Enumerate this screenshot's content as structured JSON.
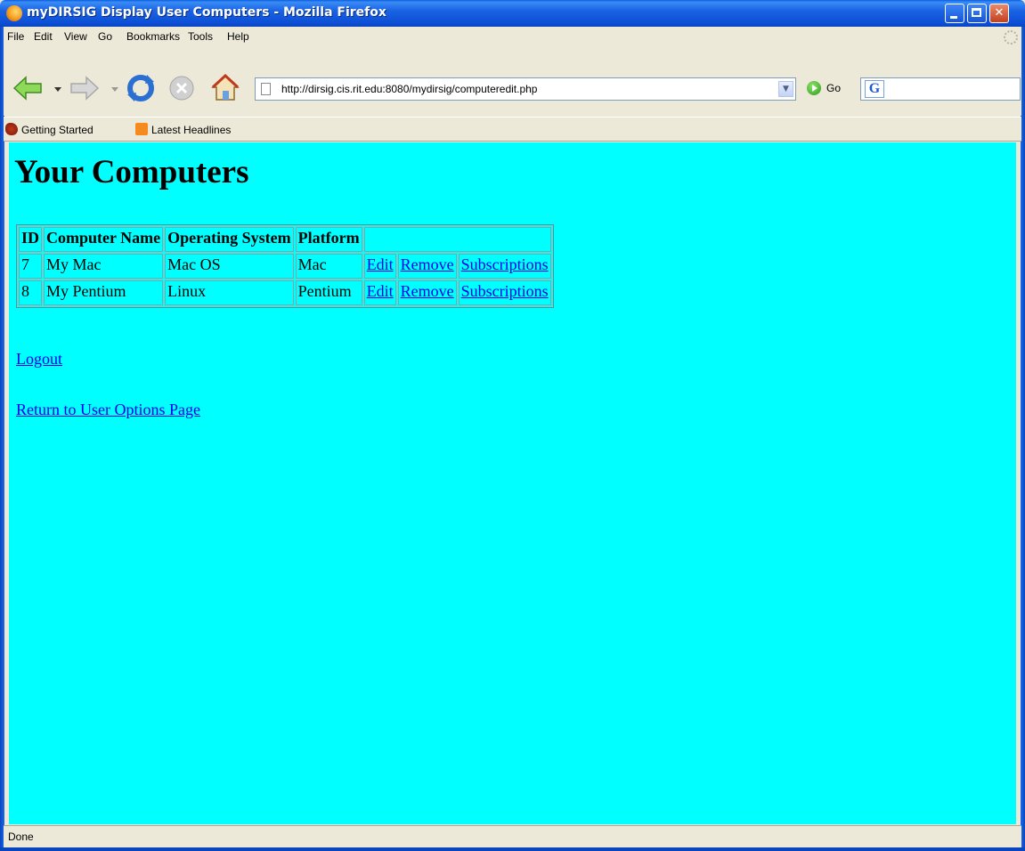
{
  "window": {
    "title": "myDIRSIG Display User Computers - Mozilla Firefox"
  },
  "menubar": {
    "items": [
      {
        "label": "File"
      },
      {
        "label": "Edit"
      },
      {
        "label": "View"
      },
      {
        "label": "Go"
      },
      {
        "label": "Bookmarks"
      },
      {
        "label": "Tools"
      },
      {
        "label": "Help"
      }
    ]
  },
  "toolbar": {
    "url": "http://dirsig.cis.rit.edu:8080/mydirsig/computeredit.php",
    "go_label": "Go",
    "search_value": "",
    "icons": [
      "back-arrow-icon",
      "forward-arrow-icon",
      "reload-icon",
      "stop-icon",
      "home-icon",
      "page-icon",
      "go-icon",
      "google-icon"
    ]
  },
  "bookmarks": {
    "items": [
      {
        "label": "Getting Started",
        "icon": "firefox-icon"
      },
      {
        "label": "Latest Headlines",
        "icon": "rss-icon"
      }
    ]
  },
  "page": {
    "background": "#00ffff",
    "link_color": "#0000ee",
    "heading": "Your Computers",
    "table": {
      "headers": [
        "ID",
        "Computer Name",
        "Operating System",
        "Platform",
        ""
      ],
      "rows": [
        {
          "id": "7",
          "name": "My Mac",
          "os": "Mac OS",
          "platform": "Mac",
          "edit": "Edit",
          "remove": "Remove",
          "subscriptions": "Subscriptions"
        },
        {
          "id": "8",
          "name": "My Pentium",
          "os": "Linux",
          "platform": "Pentium",
          "edit": "Edit",
          "remove": "Remove",
          "subscriptions": "Subscriptions"
        }
      ]
    },
    "logout_label": "Logout",
    "return_label": "Return to User Options Page"
  },
  "statusbar": {
    "text": "Done"
  }
}
